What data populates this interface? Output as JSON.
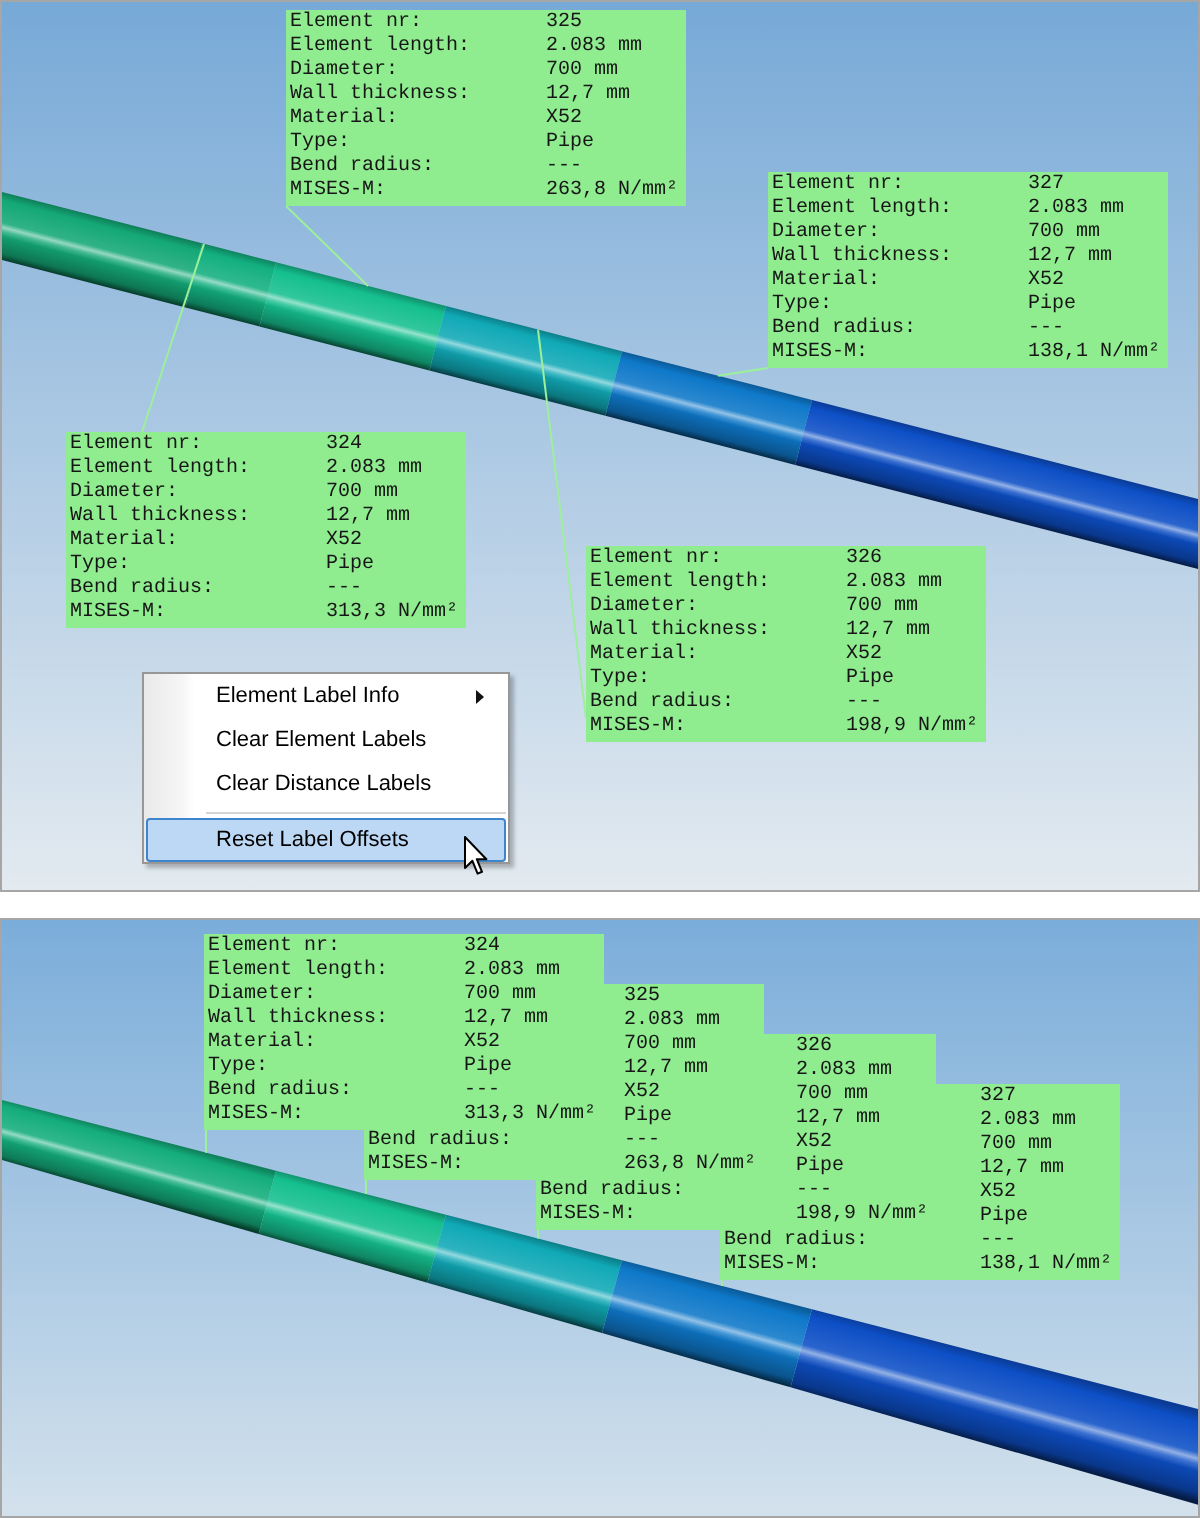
{
  "views": [
    {
      "labels": [
        {
          "rows": [
            {
              "key": "Element nr:",
              "value": "325"
            },
            {
              "key": "Element length:",
              "value": "2.083 mm"
            },
            {
              "key": "Diameter:",
              "value": "700 mm"
            },
            {
              "key": "Wall thickness:",
              "value": "12,7 mm"
            },
            {
              "key": "Material:",
              "value": "X52"
            },
            {
              "key": "Type:",
              "value": "Pipe"
            },
            {
              "key": "Bend radius:",
              "value": "---"
            },
            {
              "key": "MISES-M:",
              "value": "263,8 N/mm²"
            }
          ]
        },
        {
          "rows": [
            {
              "key": "Element nr:",
              "value": "327"
            },
            {
              "key": "Element length:",
              "value": "2.083 mm"
            },
            {
              "key": "Diameter:",
              "value": "700 mm"
            },
            {
              "key": "Wall thickness:",
              "value": "12,7 mm"
            },
            {
              "key": "Material:",
              "value": "X52"
            },
            {
              "key": "Type:",
              "value": "Pipe"
            },
            {
              "key": "Bend radius:",
              "value": "---"
            },
            {
              "key": "MISES-M:",
              "value": "138,1 N/mm²"
            }
          ]
        },
        {
          "rows": [
            {
              "key": "Element nr:",
              "value": "324"
            },
            {
              "key": "Element length:",
              "value": "2.083 mm"
            },
            {
              "key": "Diameter:",
              "value": "700 mm"
            },
            {
              "key": "Wall thickness:",
              "value": "12,7 mm"
            },
            {
              "key": "Material:",
              "value": "X52"
            },
            {
              "key": "Type:",
              "value": "Pipe"
            },
            {
              "key": "Bend radius:",
              "value": "---"
            },
            {
              "key": "MISES-M:",
              "value": "313,3 N/mm²"
            }
          ]
        },
        {
          "rows": [
            {
              "key": "Element nr:",
              "value": "326"
            },
            {
              "key": "Element length:",
              "value": "2.083 mm"
            },
            {
              "key": "Diameter:",
              "value": "700 mm"
            },
            {
              "key": "Wall thickness:",
              "value": "12,7 mm"
            },
            {
              "key": "Material:",
              "value": "X52"
            },
            {
              "key": "Type:",
              "value": "Pipe"
            },
            {
              "key": "Bend radius:",
              "value": "---"
            },
            {
              "key": "MISES-M:",
              "value": "198,9 N/mm²"
            }
          ]
        }
      ],
      "context_menu": {
        "items": [
          {
            "kind": "command",
            "label": "Element Label Info",
            "submenu": true,
            "selected": false
          },
          {
            "kind": "command",
            "label": "Clear Element Labels",
            "submenu": false,
            "selected": false
          },
          {
            "kind": "command",
            "label": "Clear Distance Labels",
            "submenu": false,
            "selected": false
          },
          {
            "kind": "separator"
          },
          {
            "kind": "command",
            "label": "Reset Label Offsets",
            "submenu": false,
            "selected": true
          }
        ]
      }
    },
    {
      "labels": [
        {
          "rows": [
            {
              "key": "Element nr:",
              "value": "324"
            },
            {
              "key": "Element length:",
              "value": "2.083 mm"
            },
            {
              "key": "Diameter:",
              "value": "700 mm"
            },
            {
              "key": "Wall thickness:",
              "value": "12,7 mm"
            },
            {
              "key": "Material:",
              "value": "X52"
            },
            {
              "key": "Type:",
              "value": "Pipe"
            },
            {
              "key": "Bend radius:",
              "value": "---"
            },
            {
              "key": "MISES-M:",
              "value": "313,3 N/mm²"
            }
          ]
        },
        {
          "rows": [
            {
              "value": "325"
            },
            {
              "value": "2.083 mm"
            },
            {
              "value": "700 mm"
            },
            {
              "value": "12,7 mm"
            },
            {
              "value": "X52"
            },
            {
              "value": "Pipe"
            },
            {
              "key": "Bend radius:",
              "value": "---"
            },
            {
              "key": "MISES-M:",
              "value": "263,8 N/mm²"
            }
          ]
        },
        {
          "rows": [
            {
              "value": "326"
            },
            {
              "value": "2.083 mm"
            },
            {
              "value": "700 mm"
            },
            {
              "value": "12,7 mm"
            },
            {
              "value": "X52"
            },
            {
              "value": "Pipe"
            },
            {
              "key": "Bend radius:",
              "value": "---"
            },
            {
              "key": "MISES-M:",
              "value": "198,9 N/mm²"
            }
          ]
        },
        {
          "rows": [
            {
              "value": "327"
            },
            {
              "value": "2.083 mm"
            },
            {
              "value": "700 mm"
            },
            {
              "value": "12,7 mm"
            },
            {
              "value": "X52"
            },
            {
              "value": "Pipe"
            },
            {
              "key": "Bend radius:",
              "value": "---"
            },
            {
              "key": "MISES-M:",
              "value": "138,1 N/mm²"
            }
          ]
        }
      ]
    }
  ]
}
